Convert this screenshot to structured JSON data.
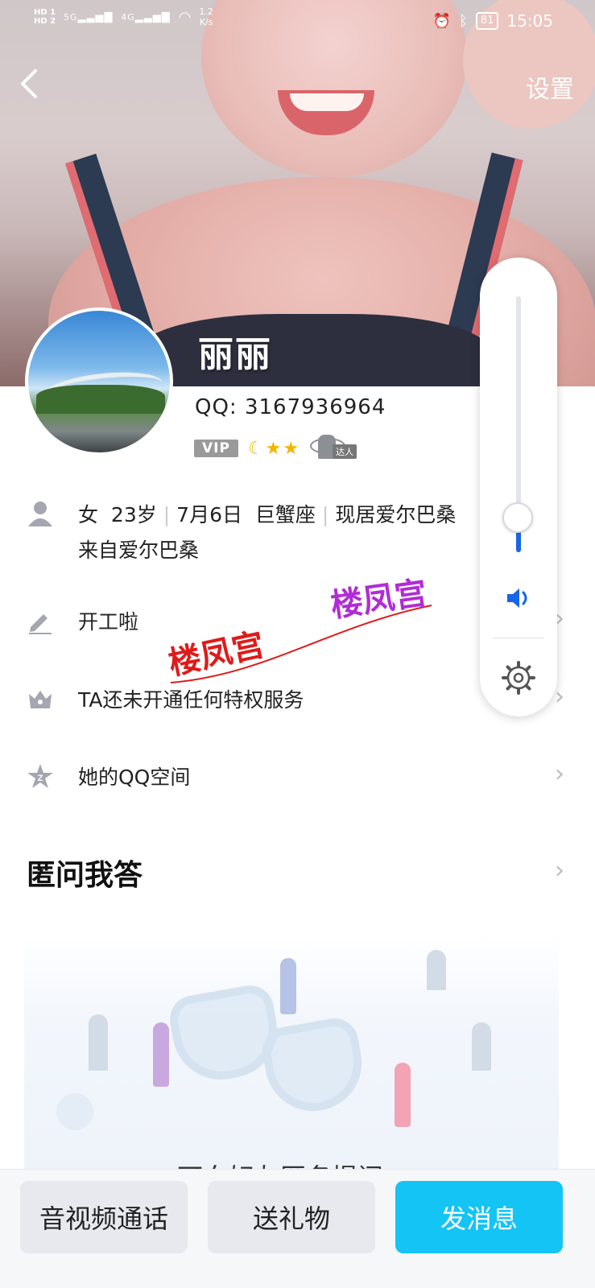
{
  "status_bar": {
    "hd1": "HD 1",
    "hd2": "HD 2",
    "net1": "5G",
    "net2": "4G",
    "speed_value": "1.2",
    "speed_unit": "K/s",
    "battery": "81",
    "time": "15:05"
  },
  "nav": {
    "back_icon": "chevron-left-icon",
    "settings_label": "设置"
  },
  "profile": {
    "name": "丽丽",
    "qq_label": "QQ:",
    "qq_number": "3167936964",
    "vip_label": "VIP",
    "level_icons": "☾★★",
    "daren_label": "达人"
  },
  "info": {
    "gender": "女",
    "age": "23岁",
    "birthday": "7月6日",
    "zodiac": "巨蟹座",
    "location": "现居爱尔巴桑",
    "hometown": "来自爱尔巴桑",
    "signature": "开工啦",
    "privilege": "TA还未开通任何特权服务",
    "qzone": "她的QQ空间"
  },
  "section": {
    "title": "匿问我答",
    "prompt_partial": "可向好友匿名提问"
  },
  "watermark": {
    "text1": "楼凤宫",
    "text2": "楼凤宫"
  },
  "actions": {
    "call": "音视频通话",
    "gift": "送礼物",
    "message": "发消息"
  },
  "colors": {
    "accent": "#14c4f5",
    "volume_blue": "#1766e8",
    "icon_grey": "#a4a7b2"
  },
  "volume": {
    "level_percent": 14
  }
}
